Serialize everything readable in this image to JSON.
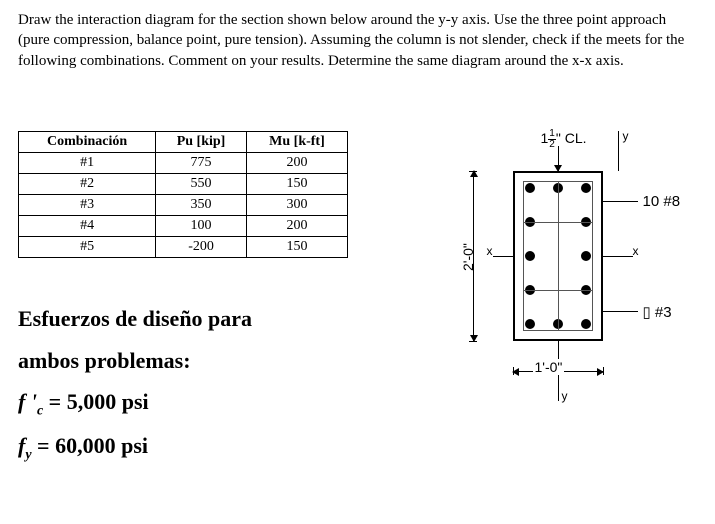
{
  "problem": "Draw the interaction diagram for the section shown below around the y-y axis. Use the three point approach (pure compression, balance point, pure tension). Assuming the column is not slender, check if the meets for the following combinations. Comment on your results. Determine the same diagram around the x-x axis.",
  "table": {
    "headers": {
      "c0": "Combinación",
      "c1": "Pu [kip]",
      "c2": "Mu [k-ft]"
    },
    "rows": [
      {
        "c0": "#1",
        "c1": "775",
        "c2": "200"
      },
      {
        "c0": "#2",
        "c1": "550",
        "c2": "150"
      },
      {
        "c0": "#3",
        "c1": "350",
        "c2": "300"
      },
      {
        "c0": "#4",
        "c1": "100",
        "c2": "200"
      },
      {
        "c0": "#5",
        "c1": "-200",
        "c2": "150"
      }
    ]
  },
  "design": {
    "title1": "Esfuerzos de diseño para",
    "title2": "ambos problemas:",
    "fc_label": "f '",
    "fc_sub": "c",
    "fc_val": " = 5,000 psi",
    "fy_label": "f",
    "fy_sub": "y",
    "fy_val": " = 60,000 psi"
  },
  "diagram": {
    "cover": "1½\" CL.",
    "bars": "10 #8",
    "ties": "▯ #3",
    "height": "2'-0\"",
    "width": "1'-0\"",
    "axis_x": "x",
    "axis_y": "y"
  }
}
